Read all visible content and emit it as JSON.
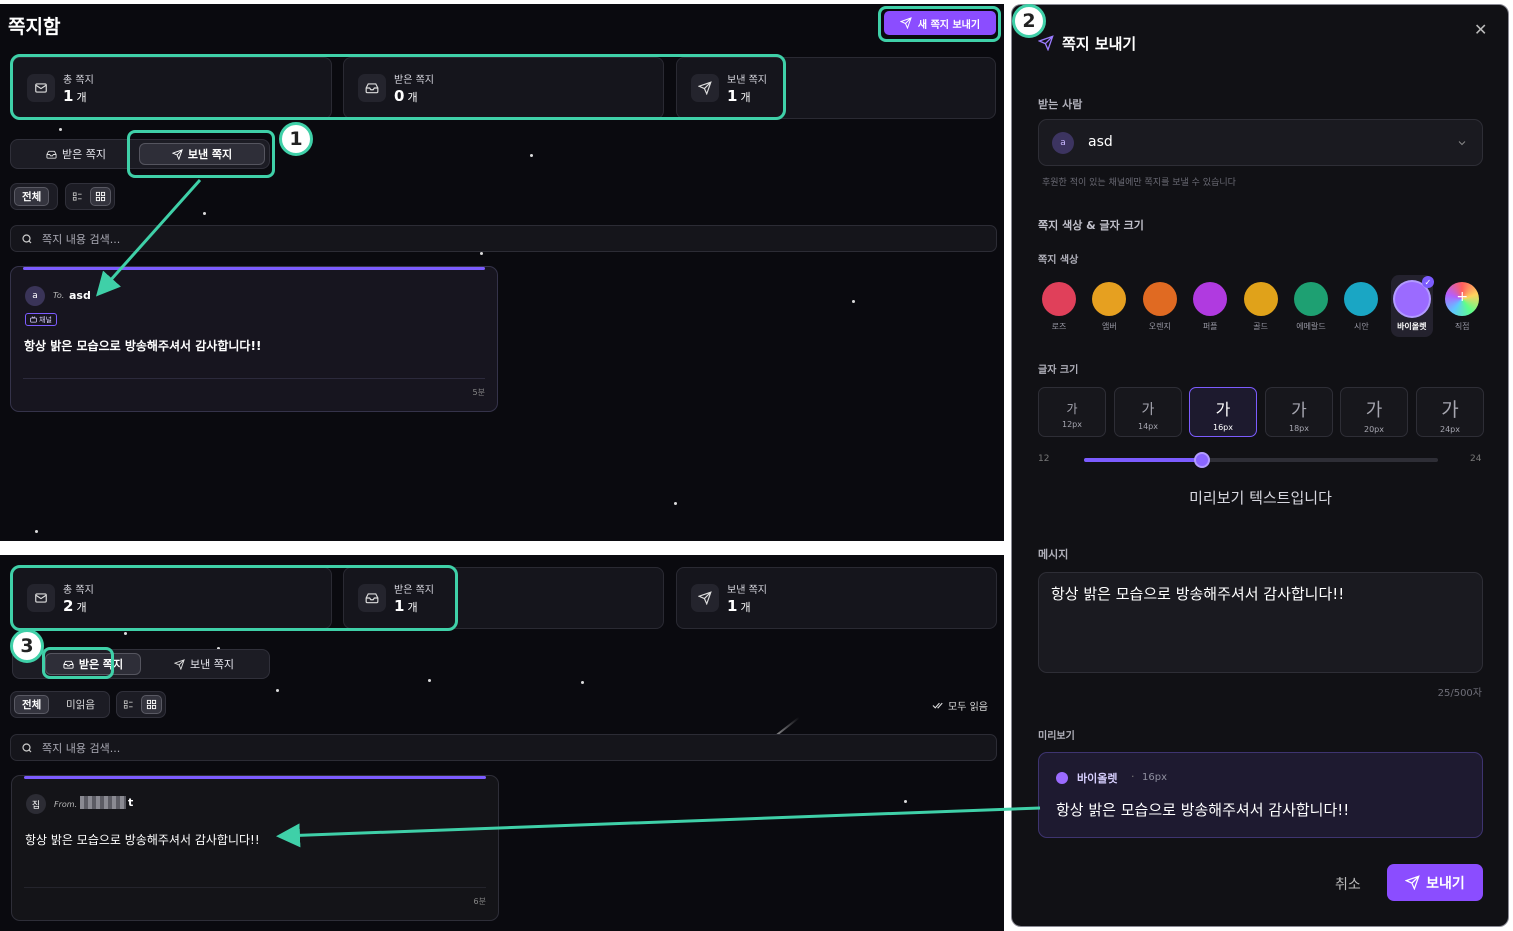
{
  "top": {
    "page_title": "쪽지함",
    "new_message_button": "새 쪽지 보내기",
    "stats": [
      {
        "label": "총 쪽지",
        "value": "1",
        "unit": "개"
      },
      {
        "label": "받은 쪽지",
        "value": "0",
        "unit": "개"
      },
      {
        "label": "보낸 쪽지",
        "value": "1",
        "unit": "개"
      }
    ],
    "tabs": {
      "received": "받은 쪽지",
      "sent": "보낸 쪽지"
    },
    "filter_all": "전체",
    "search_placeholder": "쪽지 내용 검색...",
    "card": {
      "avatar": "a",
      "to_prefix": "To.",
      "recipient": "asd",
      "badge": "채널",
      "message": "항상 밝은 모습으로 방송해주셔서 감사합니다!!",
      "time": "5분"
    }
  },
  "bottom": {
    "stats": [
      {
        "label": "총 쪽지",
        "value": "2",
        "unit": "개"
      },
      {
        "label": "받은 쪽지",
        "value": "1",
        "unit": "개"
      },
      {
        "label": "보낸 쪽지",
        "value": "1",
        "unit": "개"
      }
    ],
    "tabs": {
      "received": "받은 쪽지",
      "sent": "보낸 쪽지"
    },
    "filter_all": "전체",
    "filter_unread": "미읽음",
    "mark_all_read": "모두 읽음",
    "search_placeholder": "쪽지 내용 검색...",
    "card": {
      "avatar": "집",
      "from_prefix": "From.",
      "sender_tail": "t",
      "message": "항상 밝은 모습으로 방송해주셔서 감사합니다!!",
      "time": "6분"
    }
  },
  "modal": {
    "title": "쪽지 보내기",
    "recipient_label": "받는 사람",
    "recipient_avatar": "a",
    "recipient_value": "asd",
    "recipient_hint": "후원한 적이 있는 채널에만 쪽지를 보낼 수 있습니다",
    "style_section": "쪽지 색상 & 글자 크기",
    "color_label": "쪽지 색상",
    "colors": [
      {
        "name": "로즈",
        "hex": "#e0405a"
      },
      {
        "name": "앰버",
        "hex": "#e6a020"
      },
      {
        "name": "오렌지",
        "hex": "#e06a22"
      },
      {
        "name": "퍼플",
        "hex": "#b03ae0"
      },
      {
        "name": "골드",
        "hex": "#e0a21a"
      },
      {
        "name": "에메랄드",
        "hex": "#1ea072"
      },
      {
        "name": "시안",
        "hex": "#1aa6c4"
      },
      {
        "name": "바이올렛",
        "hex": "#9b6bff"
      },
      {
        "name": "직접",
        "hex": "#888888"
      }
    ],
    "selected_color": "바이올렛",
    "size_label": "글자 크기",
    "sizes": [
      {
        "glyph": "가",
        "px": "12px"
      },
      {
        "glyph": "가",
        "px": "14px"
      },
      {
        "glyph": "가",
        "px": "16px"
      },
      {
        "glyph": "가",
        "px": "18px"
      },
      {
        "glyph": "가",
        "px": "20px"
      },
      {
        "glyph": "가",
        "px": "24px"
      }
    ],
    "selected_size": "16px",
    "slider": {
      "min": "12",
      "max": "24",
      "value": 16
    },
    "preview_text": "미리보기 텍스트입니다",
    "message_label": "메시지",
    "message_value": "항상 밝은 모습으로 방송해주셔서 감사합니다!!",
    "char_count": "25/500자",
    "preview_label": "미리보기",
    "preview_color": "바이올렛",
    "preview_size": "16px",
    "preview_message": "항상 밝은 모습으로 방송해주셔서 감사합니다!!",
    "cancel": "취소",
    "send": "보내기"
  },
  "steps": [
    "1",
    "2",
    "3"
  ],
  "accent": "#7c5cff",
  "highlight": "#3fd0a8"
}
